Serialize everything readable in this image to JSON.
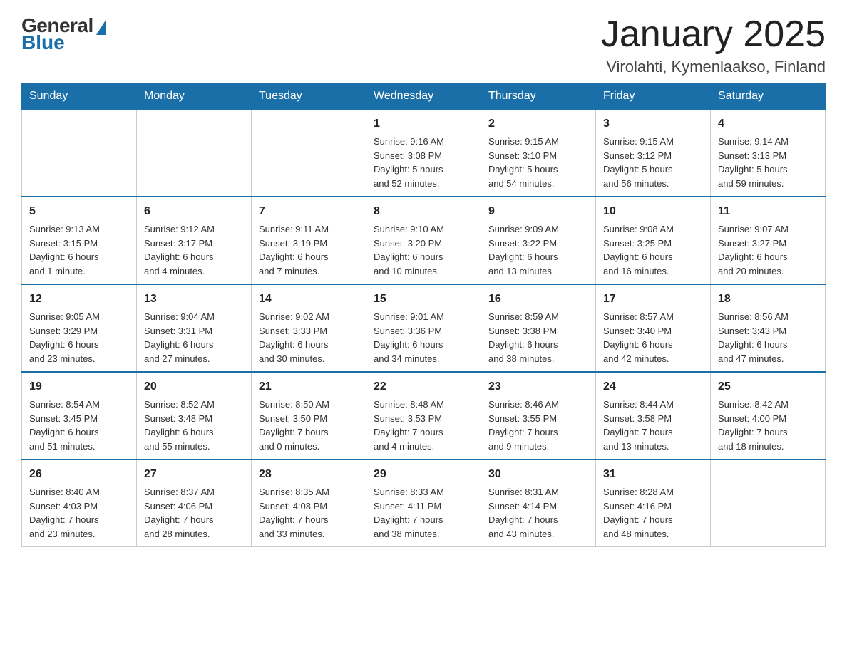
{
  "logo": {
    "general": "General",
    "blue": "Blue"
  },
  "title": {
    "month": "January 2025",
    "location": "Virolahti, Kymenlaakso, Finland"
  },
  "weekdays": [
    "Sunday",
    "Monday",
    "Tuesday",
    "Wednesday",
    "Thursday",
    "Friday",
    "Saturday"
  ],
  "weeks": [
    [
      {
        "day": "",
        "info": ""
      },
      {
        "day": "",
        "info": ""
      },
      {
        "day": "",
        "info": ""
      },
      {
        "day": "1",
        "info": "Sunrise: 9:16 AM\nSunset: 3:08 PM\nDaylight: 5 hours\nand 52 minutes."
      },
      {
        "day": "2",
        "info": "Sunrise: 9:15 AM\nSunset: 3:10 PM\nDaylight: 5 hours\nand 54 minutes."
      },
      {
        "day": "3",
        "info": "Sunrise: 9:15 AM\nSunset: 3:12 PM\nDaylight: 5 hours\nand 56 minutes."
      },
      {
        "day": "4",
        "info": "Sunrise: 9:14 AM\nSunset: 3:13 PM\nDaylight: 5 hours\nand 59 minutes."
      }
    ],
    [
      {
        "day": "5",
        "info": "Sunrise: 9:13 AM\nSunset: 3:15 PM\nDaylight: 6 hours\nand 1 minute."
      },
      {
        "day": "6",
        "info": "Sunrise: 9:12 AM\nSunset: 3:17 PM\nDaylight: 6 hours\nand 4 minutes."
      },
      {
        "day": "7",
        "info": "Sunrise: 9:11 AM\nSunset: 3:19 PM\nDaylight: 6 hours\nand 7 minutes."
      },
      {
        "day": "8",
        "info": "Sunrise: 9:10 AM\nSunset: 3:20 PM\nDaylight: 6 hours\nand 10 minutes."
      },
      {
        "day": "9",
        "info": "Sunrise: 9:09 AM\nSunset: 3:22 PM\nDaylight: 6 hours\nand 13 minutes."
      },
      {
        "day": "10",
        "info": "Sunrise: 9:08 AM\nSunset: 3:25 PM\nDaylight: 6 hours\nand 16 minutes."
      },
      {
        "day": "11",
        "info": "Sunrise: 9:07 AM\nSunset: 3:27 PM\nDaylight: 6 hours\nand 20 minutes."
      }
    ],
    [
      {
        "day": "12",
        "info": "Sunrise: 9:05 AM\nSunset: 3:29 PM\nDaylight: 6 hours\nand 23 minutes."
      },
      {
        "day": "13",
        "info": "Sunrise: 9:04 AM\nSunset: 3:31 PM\nDaylight: 6 hours\nand 27 minutes."
      },
      {
        "day": "14",
        "info": "Sunrise: 9:02 AM\nSunset: 3:33 PM\nDaylight: 6 hours\nand 30 minutes."
      },
      {
        "day": "15",
        "info": "Sunrise: 9:01 AM\nSunset: 3:36 PM\nDaylight: 6 hours\nand 34 minutes."
      },
      {
        "day": "16",
        "info": "Sunrise: 8:59 AM\nSunset: 3:38 PM\nDaylight: 6 hours\nand 38 minutes."
      },
      {
        "day": "17",
        "info": "Sunrise: 8:57 AM\nSunset: 3:40 PM\nDaylight: 6 hours\nand 42 minutes."
      },
      {
        "day": "18",
        "info": "Sunrise: 8:56 AM\nSunset: 3:43 PM\nDaylight: 6 hours\nand 47 minutes."
      }
    ],
    [
      {
        "day": "19",
        "info": "Sunrise: 8:54 AM\nSunset: 3:45 PM\nDaylight: 6 hours\nand 51 minutes."
      },
      {
        "day": "20",
        "info": "Sunrise: 8:52 AM\nSunset: 3:48 PM\nDaylight: 6 hours\nand 55 minutes."
      },
      {
        "day": "21",
        "info": "Sunrise: 8:50 AM\nSunset: 3:50 PM\nDaylight: 7 hours\nand 0 minutes."
      },
      {
        "day": "22",
        "info": "Sunrise: 8:48 AM\nSunset: 3:53 PM\nDaylight: 7 hours\nand 4 minutes."
      },
      {
        "day": "23",
        "info": "Sunrise: 8:46 AM\nSunset: 3:55 PM\nDaylight: 7 hours\nand 9 minutes."
      },
      {
        "day": "24",
        "info": "Sunrise: 8:44 AM\nSunset: 3:58 PM\nDaylight: 7 hours\nand 13 minutes."
      },
      {
        "day": "25",
        "info": "Sunrise: 8:42 AM\nSunset: 4:00 PM\nDaylight: 7 hours\nand 18 minutes."
      }
    ],
    [
      {
        "day": "26",
        "info": "Sunrise: 8:40 AM\nSunset: 4:03 PM\nDaylight: 7 hours\nand 23 minutes."
      },
      {
        "day": "27",
        "info": "Sunrise: 8:37 AM\nSunset: 4:06 PM\nDaylight: 7 hours\nand 28 minutes."
      },
      {
        "day": "28",
        "info": "Sunrise: 8:35 AM\nSunset: 4:08 PM\nDaylight: 7 hours\nand 33 minutes."
      },
      {
        "day": "29",
        "info": "Sunrise: 8:33 AM\nSunset: 4:11 PM\nDaylight: 7 hours\nand 38 minutes."
      },
      {
        "day": "30",
        "info": "Sunrise: 8:31 AM\nSunset: 4:14 PM\nDaylight: 7 hours\nand 43 minutes."
      },
      {
        "day": "31",
        "info": "Sunrise: 8:28 AM\nSunset: 4:16 PM\nDaylight: 7 hours\nand 48 minutes."
      },
      {
        "day": "",
        "info": ""
      }
    ]
  ]
}
